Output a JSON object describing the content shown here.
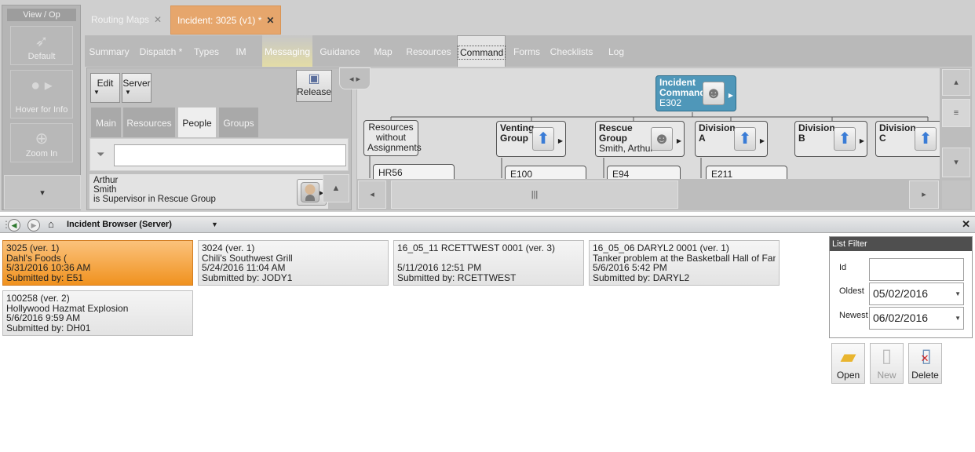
{
  "viewop": {
    "title": "View / Op",
    "buttons": [
      {
        "label": "Default"
      },
      {
        "label": "Hover for Info"
      },
      {
        "label": "Zoom In"
      }
    ]
  },
  "doc_tabs": [
    {
      "label": "Routing Maps"
    },
    {
      "label": "Incident: 3025 (v1) *"
    }
  ],
  "sub_tabs": [
    "Summary",
    "Dispatch *",
    "Types",
    "IM",
    "Messaging",
    "Guidance",
    "Map",
    "Resources",
    "Command",
    "Forms",
    "Checklists",
    "Log"
  ],
  "command_panel": {
    "edit_label": "Edit",
    "server_label": "Server",
    "release_label": "Release",
    "tabs": [
      "Main",
      "Resources",
      "People",
      "Groups"
    ],
    "person": {
      "first": "Arthur",
      "last": "Smith",
      "role": "is Supervisor in Rescue Group"
    }
  },
  "org_chart": {
    "top": {
      "title_1": "Incident",
      "title_2": "Command",
      "unit": "E302"
    },
    "unassigned": {
      "line1": "Resources",
      "line2": "without",
      "line3": "Assignments",
      "child": "HR56"
    },
    "venting": {
      "line1": "Venting",
      "line2": "Group",
      "child": "E100"
    },
    "rescue": {
      "line1": "Rescue",
      "line2": "Group",
      "person": "Smith, Arthur",
      "child": "E94"
    },
    "div_a": {
      "line1": "Division",
      "line2": "A",
      "child": "E211"
    },
    "div_b": {
      "line1": "Division",
      "line2": "B"
    },
    "div_c": {
      "line1": "Division",
      "line2": "C"
    }
  },
  "browser": {
    "title": "Incident Browser (Server)"
  },
  "incidents": [
    {
      "title": "3025 (ver. 1)",
      "name": "Dahl's Foods (",
      "date": "5/31/2016 10:36 AM",
      "submitted": "Submitted by: E51"
    },
    {
      "title": "3024 (ver. 1)",
      "name": "Chili's Southwest Grill",
      "date": "5/24/2016 11:04 AM",
      "submitted": "Submitted by: JODY1"
    },
    {
      "title": "16_05_11 RCETTWEST 0001 (ver. 3)",
      "name": "",
      "date": "5/11/2016 12:51 PM",
      "submitted": "Submitted by: RCETTWEST"
    },
    {
      "title": "16_05_06 DARYL2 0001 (ver. 1)",
      "name": "Tanker problem at the Basketball Hall of Fame",
      "date": "5/6/2016 5:42 PM",
      "submitted": "Submitted by: DARYL2"
    },
    {
      "title": "100258 (ver. 2)",
      "name": "Hollywood Hazmat Explosion",
      "date": "5/6/2016 9:59 AM",
      "submitted": "Submitted by: DH01"
    }
  ],
  "list_filter": {
    "title": "List Filter",
    "id_label": "Id",
    "id_value": "",
    "oldest_label": "Oldest",
    "oldest_value": "05/02/2016",
    "newest_label": "Newest",
    "newest_value": "06/02/2016"
  },
  "actions": {
    "open": "Open",
    "new": "New",
    "delete": "Delete"
  }
}
